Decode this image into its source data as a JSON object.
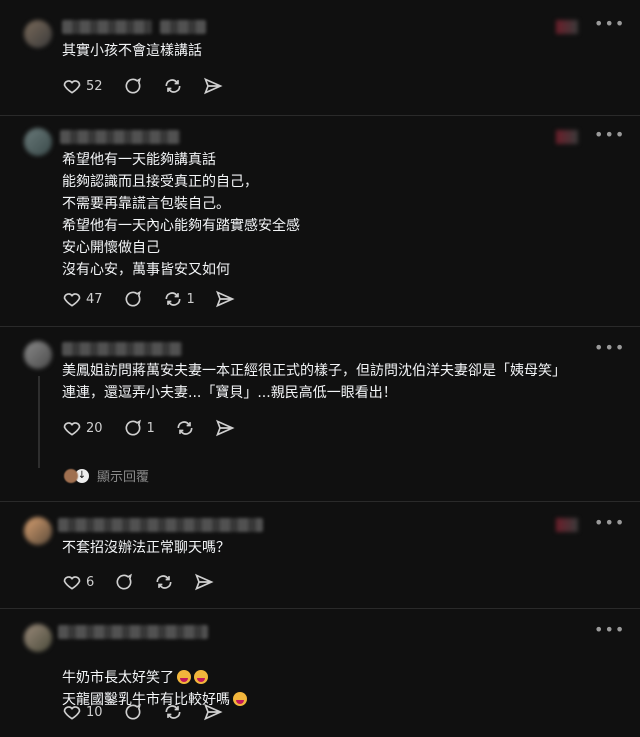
{
  "posts": [
    {
      "text": "其實小孩不會這樣講話",
      "likes": "52",
      "replies": "",
      "reposts": ""
    },
    {
      "text": "希望他有一天能夠講真話\n能夠認識而且接受真正的自己，\n不需要再靠謊言包裝自己。\n希望他有一天內心能夠有踏實感安全感\n安心開懷做自己\n沒有心安，萬事皆安又如何",
      "likes": "47",
      "replies": "",
      "reposts": "1"
    },
    {
      "text": "美鳳姐訪問蔣萬安夫妻一本正經很正式的樣子，但訪問沈伯洋夫妻卻是「姨母笑」\n連連，還逗弄小夫妻...「寶貝」...親民高低一眼看出！",
      "likes": "20",
      "replies": "1",
      "reposts": "",
      "show_replies": "顯示回覆"
    },
    {
      "text": "不套招沒辦法正常聊天嗎？",
      "likes": "6",
      "replies": "",
      "reposts": ""
    },
    {
      "text_line1": "牛奶市長太好笑了",
      "text_line2": "天龍國鑿乳牛市有比較好嗎",
      "likes": "10",
      "replies": "",
      "reposts": ""
    }
  ],
  "icons": [
    "heart-icon",
    "comment-icon",
    "repost-icon",
    "share-icon",
    "more-icon"
  ]
}
